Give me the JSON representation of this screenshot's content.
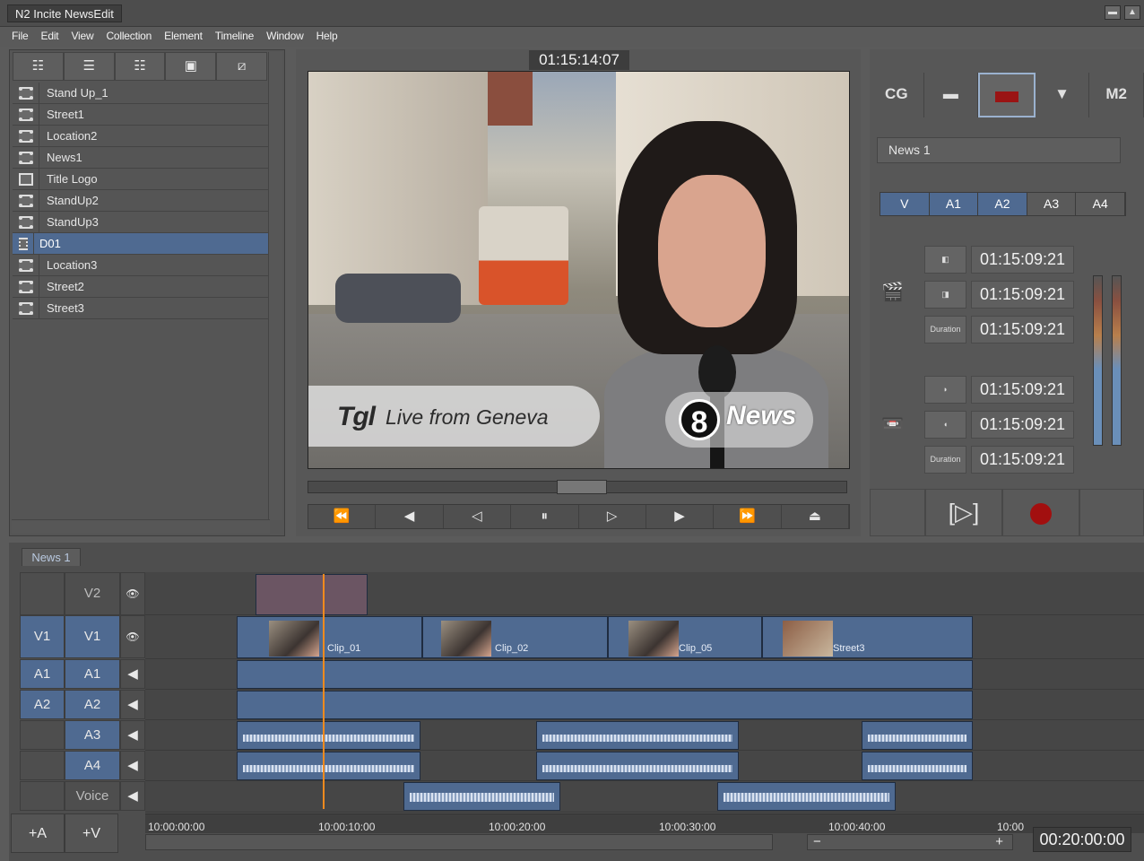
{
  "window": {
    "title": "N2 Incite NewsEdit"
  },
  "menu": [
    "File",
    "Edit",
    "View",
    "Collection",
    "Element",
    "Timeline",
    "Window",
    "Help"
  ],
  "bin": {
    "tools": [
      "☷",
      "☰",
      "☷",
      "▣",
      "⧄"
    ],
    "items": [
      "Stand Up_1",
      "Street1",
      "Location2",
      "News1",
      "Title Logo",
      "StandUp2",
      "StandUp3",
      "D01",
      "Location3",
      "Street2",
      "Street3"
    ],
    "selected_index": 7
  },
  "viewer": {
    "timecode": "01:15:14:07",
    "lower_third_logo": "Tgl",
    "lower_third_text": "Live from Geneva",
    "bug_number": "8",
    "bug_text": "News",
    "transport": [
      "⏪",
      "◀",
      "◁",
      "⏸",
      "▷",
      "▶",
      "⏩",
      "⏏"
    ]
  },
  "right": {
    "tools": [
      "CG",
      "▬",
      "",
      "▼",
      "M2"
    ],
    "sequence_name": "News 1",
    "tracks": [
      "V",
      "A1",
      "A2",
      "A3",
      "A4"
    ],
    "tracks_active": [
      true,
      true,
      true,
      false,
      false
    ],
    "source": {
      "in": "01:15:09:21",
      "out": "01:15:09:21",
      "duration": "01:15:09:21",
      "duration_label": "Duration"
    },
    "record": {
      "in": "01:15:09:21",
      "out": "01:15:09:21",
      "duration": "01:15:09:21",
      "duration_label": "Duration"
    }
  },
  "timeline": {
    "tab": "News 1",
    "tracks": [
      {
        "patch": "",
        "name": "V2"
      },
      {
        "patch": "V1",
        "name": "V1"
      },
      {
        "patch": "A1",
        "name": "A1"
      },
      {
        "patch": "A2",
        "name": "A2"
      },
      {
        "patch": "",
        "name": "A3"
      },
      {
        "patch": "",
        "name": "A4"
      },
      {
        "patch": "",
        "name": "Voice"
      }
    ],
    "clips": [
      "Clip_01",
      "Clip_02",
      "Clip_05",
      "Street3"
    ],
    "ruler": [
      "10:00:00:00",
      "10:00:10:00",
      "10:00:20:00",
      "10:00:30:00",
      "10:00:40:00",
      "10:00"
    ],
    "add_audio": "+A",
    "add_video": "+V",
    "duration": "00:20:00:00",
    "zoom_minus": "−",
    "zoom_plus": "+"
  }
}
